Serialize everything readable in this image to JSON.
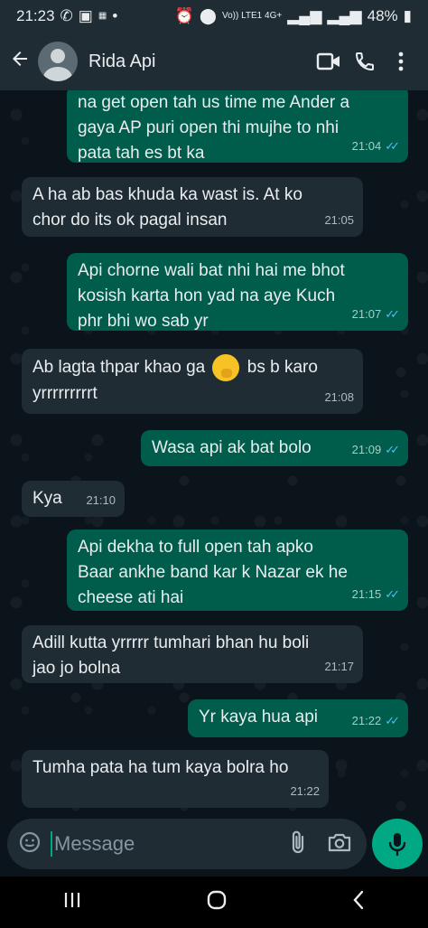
{
  "statusbar": {
    "time": "21:23",
    "network": "Vo)) LTE1 4G+",
    "battery": "48%"
  },
  "header": {
    "back_icon": "arrow-left-icon",
    "contact_name": "Rida Api",
    "video_icon": "video-call-icon",
    "call_icon": "phone-icon",
    "menu_icon": "more-vertical-icon"
  },
  "messages": [
    {
      "dir": "out",
      "text": "na get open tah us time me Ander a\ngaya AP puri open thi mujhe to nhi\npata tah es bt ka",
      "time": "21:04"
    },
    {
      "dir": "in",
      "text": "A ha ab bas khuda ka wast is. At ko\nchor do its ok pagal insan",
      "time": "21:05"
    },
    {
      "dir": "out",
      "text": "Api chorne wali bat nhi hai me bhot\nkosish karta hon yad na aye Kuch\nphr bhi wo sab yr",
      "time": "21:07"
    },
    {
      "dir": "in",
      "text_a": "Ab lagta thpar khao ga",
      "text_b": "bs b karo",
      "text_c": "yrrrrrrrrrt",
      "emoji": "face-with-hand-over-mouth-emoji",
      "time": "21:08"
    },
    {
      "dir": "out",
      "text": "Wasa api ak bat bolo",
      "time": "21:09"
    },
    {
      "dir": "in",
      "text": "Kya",
      "time": "21:10"
    },
    {
      "dir": "out",
      "text": "Api dekha to full open tah apko\nBaar ankhe band kar k Nazar ek he\ncheese ati hai",
      "time": "21:15"
    },
    {
      "dir": "in",
      "text": "Adill kutta yrrrrr tumhari bhan hu boli\njao jo bolna",
      "time": "21:17"
    },
    {
      "dir": "out",
      "text": "Yr kaya hua api",
      "time": "21:22"
    },
    {
      "dir": "in",
      "text": "Tumha pata ha tum kaya bolra ho",
      "time": "21:22"
    }
  ],
  "input": {
    "placeholder": "Message",
    "sticker_icon": "sticker-icon",
    "attach_icon": "paperclip-icon",
    "camera_icon": "camera-icon",
    "mic_icon": "microphone-icon"
  },
  "colors": {
    "incoming_bubble": "#202c33",
    "outgoing_bubble": "#005c4b",
    "accent": "#00a884",
    "read_ticks": "#53bdeb"
  }
}
